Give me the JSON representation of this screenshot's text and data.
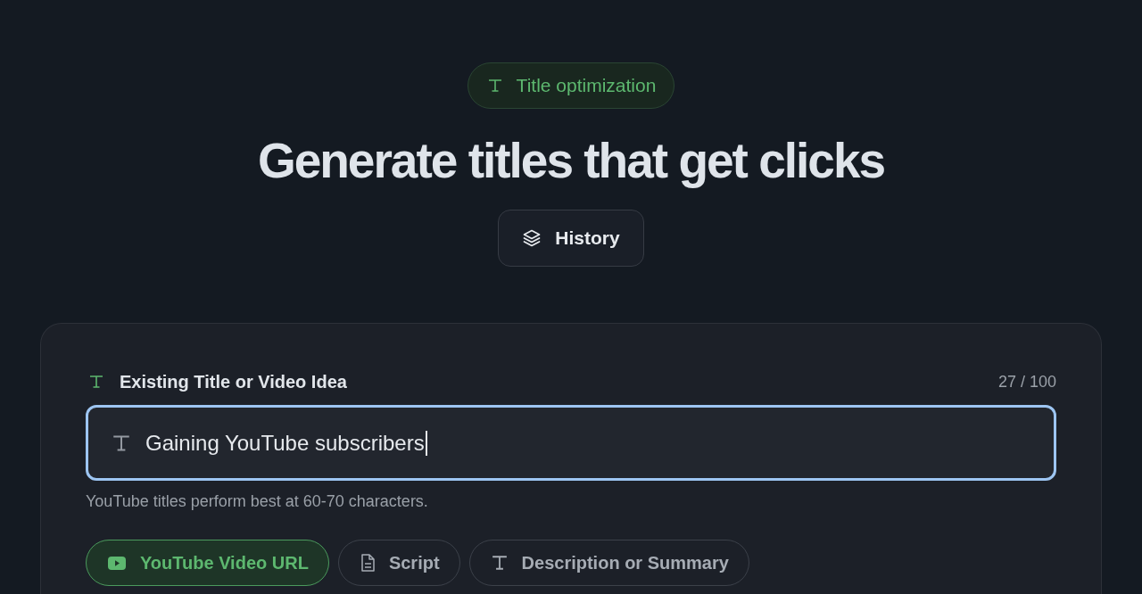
{
  "badge": {
    "label": "Title optimization"
  },
  "heading": "Generate titles that get clicks",
  "history_button": {
    "label": "History"
  },
  "title_field": {
    "label": "Existing Title or Video Idea",
    "counter": "27 / 100",
    "value": "Gaining YouTube subscribers",
    "focused": true,
    "hint": "YouTube titles perform best at 60-70 characters."
  },
  "source_options": [
    {
      "label": "YouTube Video URL",
      "kind": "video",
      "selected": true
    },
    {
      "label": "Script",
      "kind": "script",
      "selected": false
    },
    {
      "label": "Description or Summary",
      "kind": "text",
      "selected": false
    }
  ]
}
